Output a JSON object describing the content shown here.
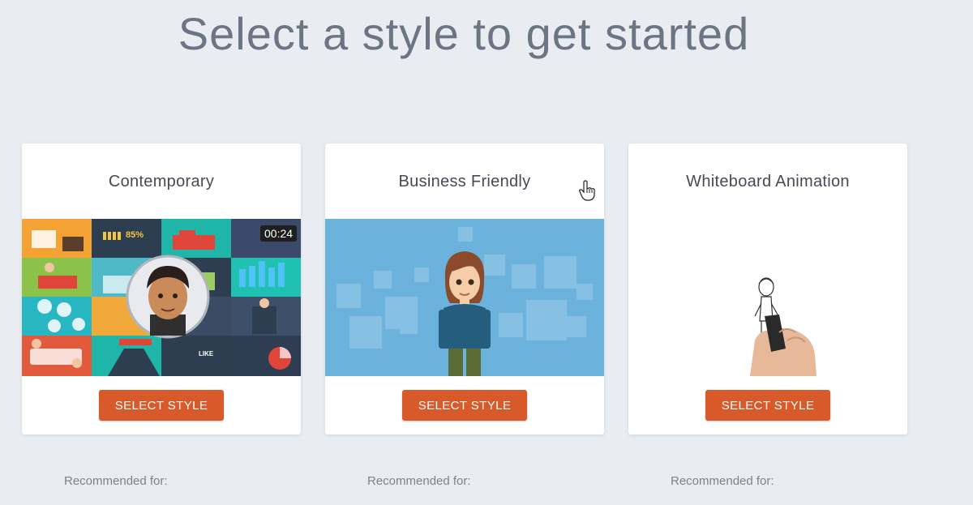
{
  "page": {
    "title": "Select a style to get started"
  },
  "cards": [
    {
      "title": "Contemporary",
      "button_label": "SELECT STYLE",
      "recommended_label": "Recommended for:",
      "preview_text": {
        "percent": "85%",
        "timer": "00:24",
        "like": "LIKE"
      }
    },
    {
      "title": "Business Friendly",
      "button_label": "SELECT STYLE",
      "recommended_label": "Recommended for:"
    },
    {
      "title": "Whiteboard Animation",
      "button_label": "SELECT STYLE",
      "recommended_label": "Recommended for:"
    }
  ],
  "colors": {
    "background": "#e9edf2",
    "accent": "#d85a2a",
    "business_bg": "#6bb3dc"
  },
  "icons": {
    "cursor": "hand-pointer-icon"
  }
}
